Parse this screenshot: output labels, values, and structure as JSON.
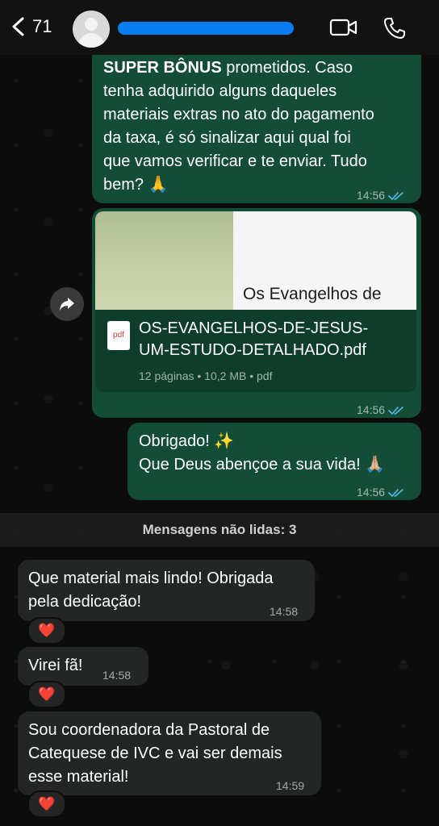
{
  "header": {
    "back_count": "71",
    "icons": {
      "back": "chevron-left-icon",
      "avatar": "person-icon",
      "video": "video-camera-icon",
      "call": "phone-icon"
    }
  },
  "colors": {
    "outgoing": "#144d37",
    "incoming": "#242626",
    "tick": "#53bdeb",
    "redaction": "#0a7df0"
  },
  "messages": {
    "m1": {
      "bold": "SUPER BÔNUS",
      "lines": [
        " prometidos. Caso",
        "tenha adquirido alguns daqueles",
        "materiais extras no ato do pagamento",
        "da taxa, é só sinalizar aqui qual foi",
        "que vamos verificar e te enviar. Tudo",
        "bem? 🙏"
      ],
      "time": "14:56"
    },
    "m2": {
      "preview_title": "Os Evangelhos de",
      "file_name_line1": "OS-EVANGELHOS-DE-JESUS-",
      "file_name_line2": "UM-ESTUDO-DETALHADO.pdf",
      "file_icon_label": "pdf",
      "meta": "12 páginas • 10,2 MB • pdf",
      "time": "14:56"
    },
    "m3": {
      "line1": "Obrigado! ✨",
      "line2": "Que Deus abençoe a sua vida! 🙏🏼",
      "time": "14:56"
    }
  },
  "unread_divider": "Mensagens não lidas: 3",
  "incoming": [
    {
      "lines": [
        "Que material mais lindo! Obrigada",
        "pela dedicação!"
      ],
      "time": "14:58",
      "reaction": "❤️"
    },
    {
      "lines": [
        "Virei fã!"
      ],
      "time": "14:58",
      "reaction": "❤️"
    },
    {
      "lines": [
        "Sou coordenadora da Pastoral de",
        "Catequese de IVC e vai ser demais",
        "esse material!"
      ],
      "time": "14:59",
      "reaction": "❤️"
    }
  ]
}
